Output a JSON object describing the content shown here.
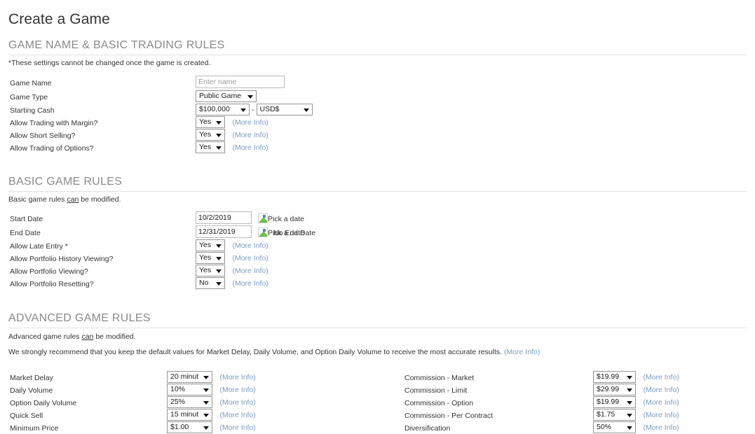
{
  "page": {
    "title": "Create a Game"
  },
  "sections": {
    "basic_trading": {
      "heading": "GAME NAME & BASIC TRADING RULES",
      "note": "*These settings cannot be changed once the game is created.",
      "rows": [
        {
          "label": "Game Name",
          "type": "text",
          "value": "",
          "placeholder": "Enter name"
        },
        {
          "label": "Game Type",
          "type": "select",
          "value": "Public Game"
        },
        {
          "label": "Starting Cash",
          "type": "select-pair",
          "value": "$100,000",
          "separator": "-",
          "value2": "USD$"
        },
        {
          "label": "Allow Trading with Margin?",
          "type": "select",
          "value": "Yes",
          "more_info": "(More Info)"
        },
        {
          "label": "Allow Short Selling?",
          "type": "select",
          "value": "Yes",
          "more_info": "(More Info)"
        },
        {
          "label": "Allow Trading of Options?",
          "type": "select",
          "value": "Yes",
          "more_info": "(More Info)"
        }
      ]
    },
    "basic_rules": {
      "heading": "BASIC GAME RULES",
      "note_pre": "Basic game rules ",
      "note_underline": "can",
      "note_post": " be modified.",
      "rows": [
        {
          "label": "Start Date",
          "type": "date",
          "value": "10/2/2019",
          "picker_alt": "Pick a date"
        },
        {
          "label": "End Date",
          "type": "date-2",
          "value": "12/31/2019",
          "picker_alt": "Pick a date",
          "picker_alt2": "No End Date"
        },
        {
          "label": "Allow Late Entry *",
          "type": "select",
          "value": "Yes",
          "more_info": "(More Info)"
        },
        {
          "label": "Allow Portfolio History Viewing?",
          "type": "select",
          "value": "Yes",
          "more_info": "(More Info)"
        },
        {
          "label": "Allow Portfolio Viewing?",
          "type": "select",
          "value": "Yes",
          "more_info": "(More Info)"
        },
        {
          "label": "Allow Portfolio Resetting?",
          "type": "select",
          "value": "No",
          "more_info": "(More Info)"
        }
      ]
    },
    "advanced_rules": {
      "heading": "ADVANCED GAME RULES",
      "note_pre": "Advanced game rules ",
      "note_underline": "can",
      "note_post": " be modified.",
      "recommend_text": "We strongly recommend that you keep the default values for Market Delay, Daily Volume, and Option Daily Volume to receive the most accurate results.",
      "recommend_more_info": "(More Info)",
      "left_rows": [
        {
          "label": "Market Delay",
          "value": "20 minut",
          "more_info": "(More Info)"
        },
        {
          "label": "Daily Volume",
          "value": "10%",
          "more_info": "(More Info)"
        },
        {
          "label": "Option Daily Volume",
          "value": "25%",
          "more_info": "(More Info)"
        },
        {
          "label": "Quick Sell",
          "value": "15 minut",
          "more_info": "(More Info)"
        },
        {
          "label": "Minimum Price",
          "value": "$1.00",
          "more_info": "(More Info)"
        }
      ],
      "right_rows": [
        {
          "label": "Commission - Market",
          "value": "$19.99",
          "more_info": "(More Info)"
        },
        {
          "label": "Commission - Limit",
          "value": "$29.99",
          "more_info": "(More Info)"
        },
        {
          "label": "Commission - Option",
          "value": "$19.99",
          "more_info": "(More Info)"
        },
        {
          "label": "Commission - Per Contract",
          "value": "$1.75",
          "more_info": "(More Info)"
        },
        {
          "label": "Diversification",
          "value": "50%",
          "more_info": "(More Info)"
        }
      ]
    }
  },
  "colors": {
    "heading": "#8a8a8a",
    "link": "#7a9cc6",
    "text": "#333333",
    "border": "#949494",
    "rule": "#e2e2e2"
  }
}
